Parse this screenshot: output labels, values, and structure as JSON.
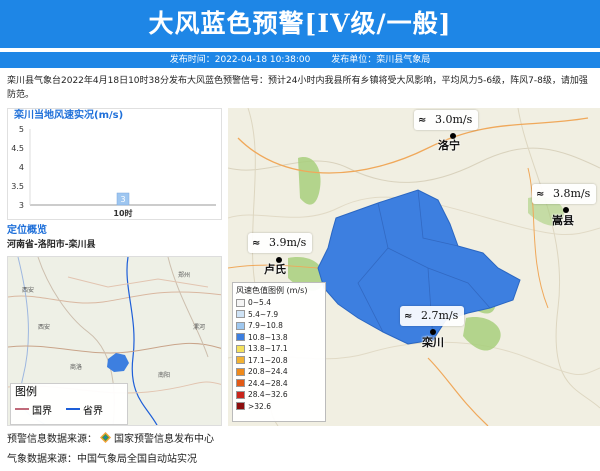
{
  "banner": {
    "title": "大风蓝色预警[IV级/一般]"
  },
  "meta": {
    "time": "发布时间：2022-04-18 10:38:00",
    "unit": "发布单位：栾川县气象局"
  },
  "description": "栾川县气象台2022年4月18日10时38分发布大风蓝色预警信号：预计24小时内我县所有乡镇将受大风影响，平均风力5-6级，阵风7-8级，请加强防范。",
  "chart_data": {
    "type": "bar",
    "title": "栾川当地风速实况(m/s)",
    "categories": [
      "10时"
    ],
    "values": [
      3
    ],
    "ylim": [
      3,
      5
    ],
    "yticks": [
      "5",
      "4.5",
      "4",
      "3.5",
      "3"
    ],
    "data_labels": [
      "3"
    ],
    "bar_color": "#9ec6f0"
  },
  "locate": {
    "title": "定位概览",
    "path": "河南省-洛阳市-栾川县",
    "legend_title": "图例",
    "legend_items": [
      {
        "label": "国界",
        "color": "#c06a7a"
      },
      {
        "label": "省界",
        "color": "#1d5ed8"
      }
    ],
    "mini_map_labels": [
      "西安",
      "郑州",
      "西安",
      "商洛",
      "南阳",
      "漯河"
    ]
  },
  "map": {
    "stations": [
      {
        "name": "洛宁",
        "speed": "3.0m/s"
      },
      {
        "name": "嵩县",
        "speed": "3.8m/s"
      },
      {
        "name": "卢氏",
        "speed": "3.9m/s"
      },
      {
        "name": "栾川",
        "speed": "2.7m/s"
      }
    ],
    "wind_icon": "wind-arrow-icon"
  },
  "legend": {
    "title": "风速色值图例 (m/s)",
    "items": [
      {
        "label": "0~5.4",
        "color": "#f4f4f4"
      },
      {
        "label": "5.4~7.9",
        "color": "#cfe3f5"
      },
      {
        "label": "7.9~10.8",
        "color": "#9fc8ef"
      },
      {
        "label": "10.8~13.8",
        "color": "#3d7fe0"
      },
      {
        "label": "13.8~17.1",
        "color": "#f4e15c"
      },
      {
        "label": "17.1~20.8",
        "color": "#f2b233"
      },
      {
        "label": "20.8~24.4",
        "color": "#ef8a1c"
      },
      {
        "label": "24.4~28.4",
        "color": "#e25a16"
      },
      {
        "label": "28.4~32.6",
        "color": "#c9251b"
      },
      {
        "label": ">32.6",
        "color": "#8c0d0d"
      }
    ]
  },
  "footer": {
    "warning_source": "预警信息数据来源：",
    "warning_source_name": "国家预警信息发布中心",
    "weather_source": "气象数据来源：中国气象局全国自动站实况"
  },
  "colors": {
    "accent": "#1e86e6",
    "warning_area": "#3d7fe0"
  }
}
